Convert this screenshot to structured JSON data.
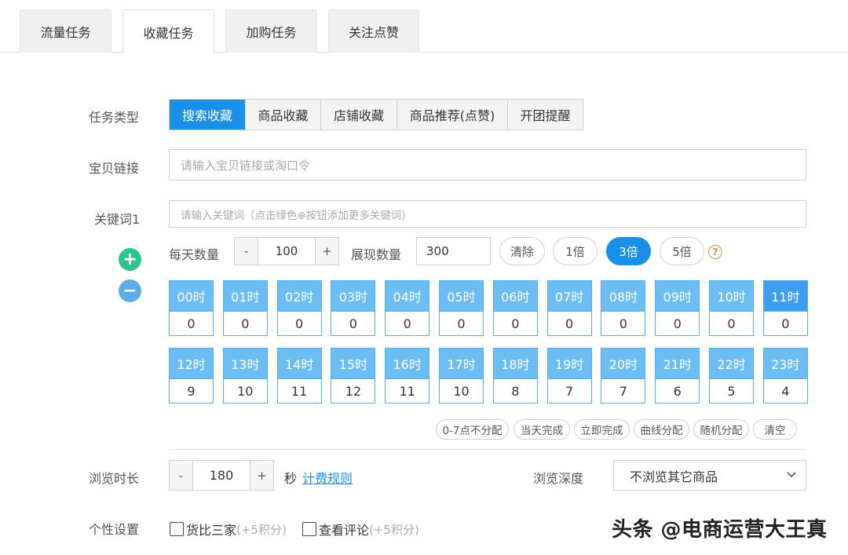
{
  "tabs": [
    "流量任务",
    "收藏任务",
    "加购任务",
    "关注点赞"
  ],
  "form": {
    "task_type_label": "任务类型",
    "task_types": [
      "搜索收藏",
      "商品收藏",
      "店铺收藏",
      "商品推荐(点赞)",
      "开团提醒"
    ],
    "link_label": "宝贝链接",
    "link_placeholder": "请输入宝贝链接或淘口令",
    "keyword_label": "关键词1",
    "keyword_placeholder": "请输入关键词（点击绿色⊕按钮添加更多关键词）",
    "daily_label": "每天数量",
    "daily_value": "100",
    "show_label": "展现数量",
    "show_value": "300",
    "clear_label": "清除",
    "multipliers": [
      "1倍",
      "3倍",
      "5倍"
    ],
    "hours_top": [
      {
        "label": "00时",
        "value": "0"
      },
      {
        "label": "01时",
        "value": "0"
      },
      {
        "label": "02时",
        "value": "0"
      },
      {
        "label": "03时",
        "value": "0"
      },
      {
        "label": "04时",
        "value": "0"
      },
      {
        "label": "05时",
        "value": "0"
      },
      {
        "label": "06时",
        "value": "0"
      },
      {
        "label": "07时",
        "value": "0"
      },
      {
        "label": "08时",
        "value": "0"
      },
      {
        "label": "09时",
        "value": "0"
      },
      {
        "label": "10时",
        "value": "0"
      },
      {
        "label": "11时",
        "value": "0"
      }
    ],
    "hours_bottom": [
      {
        "label": "12时",
        "value": "9"
      },
      {
        "label": "13时",
        "value": "10"
      },
      {
        "label": "14时",
        "value": "11"
      },
      {
        "label": "15时",
        "value": "12"
      },
      {
        "label": "16时",
        "value": "11"
      },
      {
        "label": "17时",
        "value": "10"
      },
      {
        "label": "18时",
        "value": "8"
      },
      {
        "label": "19时",
        "value": "7"
      },
      {
        "label": "20时",
        "value": "7"
      },
      {
        "label": "21时",
        "value": "6"
      },
      {
        "label": "22时",
        "value": "5"
      },
      {
        "label": "23时",
        "value": "4"
      }
    ],
    "distribution": [
      "0-7点不分配",
      "当天完成",
      "立即完成",
      "曲线分配",
      "随机分配",
      "清空"
    ],
    "browse_label": "浏览时长",
    "browse_value": "180",
    "browse_unit": "秒",
    "fee_link": "计费规则",
    "depth_label": "浏览深度",
    "depth_value": "不浏览其它商品",
    "personal_label": "个性设置",
    "options": [
      {
        "label": "货比三家",
        "extra": "(+5积分)"
      },
      {
        "label": "查看评论",
        "extra": "(+5积分)"
      }
    ]
  },
  "watermark": "头条 @电商运营大王真",
  "colors": {
    "primary": "#1a8fe8",
    "add": "#2fc48d",
    "remove": "#5aaee8",
    "help": "#e08a2c"
  }
}
